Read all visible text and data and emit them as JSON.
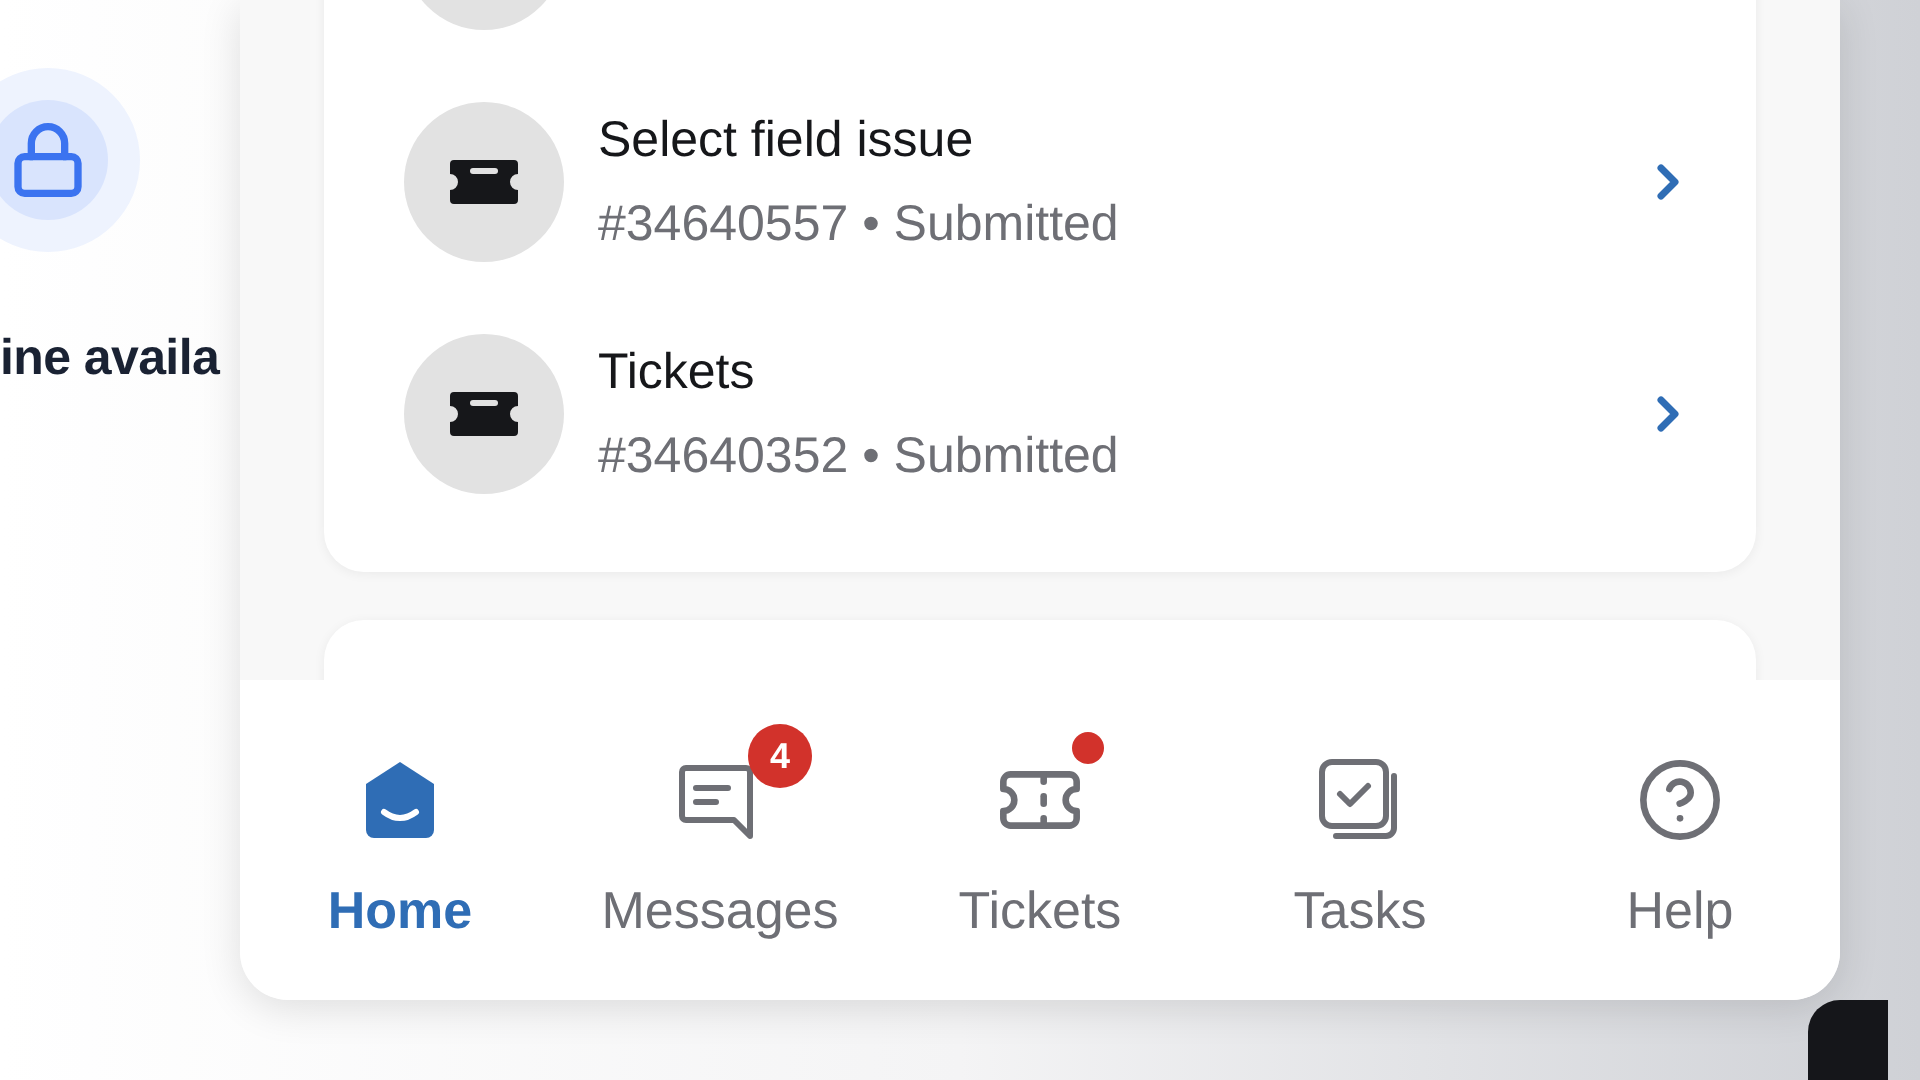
{
  "background_panel": {
    "text": "ine availa"
  },
  "tickets": [
    {
      "title": "Select field issue",
      "subtitle": "#34640557 • Submitted"
    },
    {
      "title": "Tickets",
      "subtitle": "#34640352 • Submitted"
    }
  ],
  "nav": [
    {
      "label": "Home",
      "kind": "home",
      "selected": true
    },
    {
      "label": "Messages",
      "kind": "messages",
      "selected": false,
      "badge": "4"
    },
    {
      "label": "Tickets",
      "kind": "tickets",
      "selected": false,
      "dot": true
    },
    {
      "label": "Tasks",
      "kind": "tasks",
      "selected": false
    },
    {
      "label": "Help",
      "kind": "help",
      "selected": false
    }
  ]
}
